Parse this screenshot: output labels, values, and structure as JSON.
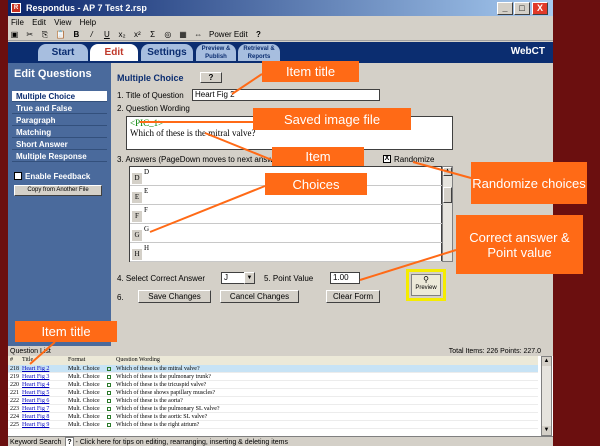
{
  "window": {
    "title": "Respondus - AP 7 Test 2.rsp",
    "controls": [
      "_",
      "□",
      "X"
    ]
  },
  "menu": [
    "File",
    "Edit",
    "View",
    "Help"
  ],
  "toolbar": [
    "▣",
    "✂",
    "⎘",
    "📋",
    "B",
    "/",
    "U",
    "x₂",
    "x²",
    "Σ",
    "◎",
    "▦",
    "⇔",
    "Power Edit",
    "?"
  ],
  "tabs": {
    "start": "Start",
    "edit": "Edit",
    "settings": "Settings",
    "preview_publish": "Preview & Publish",
    "retrieval_reports": "Retrieval & Reports",
    "brand": "WebCT"
  },
  "sidebar": {
    "heading": "Edit Questions",
    "items": [
      {
        "label": "Multiple Choice",
        "active": true
      },
      {
        "label": "True and False"
      },
      {
        "label": "Paragraph"
      },
      {
        "label": "Matching"
      },
      {
        "label": "Short Answer"
      },
      {
        "label": "Multiple Response"
      }
    ],
    "enable_feedback": "Enable Feedback",
    "copy_button": "Copy from Another File"
  },
  "form": {
    "type_title": "Multiple Choice",
    "help_button": "?",
    "step1_label": "1.   Title of Question",
    "title_value": "Heart Fig 2",
    "step2_label": "2.   Question Wording",
    "wording_tag": "<PIC_1>",
    "wording_text": "Which of these is the mitral valve?",
    "step3_label": "3.   Answers  (PageDown moves to next answer)",
    "randomize_label": "Randomize",
    "randomize_mark": "X",
    "choices": [
      {
        "letter": "D",
        "text": "D"
      },
      {
        "letter": "E",
        "text": "E"
      },
      {
        "letter": "F",
        "text": "F"
      },
      {
        "letter": "G",
        "text": "G"
      },
      {
        "letter": "H",
        "text": "H"
      }
    ],
    "step4_label": "4.   Select Correct Answer",
    "correct_answer": "J",
    "step5_label": "5.   Point Value",
    "point_value": "1.00",
    "step6_label": "6.",
    "save_button": "Save Changes",
    "cancel_button": "Cancel Changes",
    "clear_button": "Clear Form",
    "preview_button": "Preview"
  },
  "question_list": {
    "title": "Question List",
    "totals": "Total Items: 226  Points: 227.0",
    "columns": [
      "#",
      "Title",
      "Format",
      "",
      "Question Wording"
    ],
    "rows": [
      {
        "num": "218",
        "title": "Heart Fig 2",
        "format": "Mult. Choice",
        "wording": "Which of these is the mitral valve?",
        "selected": true
      },
      {
        "num": "219",
        "title": "Heart Fig 3",
        "format": "Mult. Choice",
        "wording": "Which of these is the pulmonary trunk?"
      },
      {
        "num": "220",
        "title": "Heart Fig 4",
        "format": "Mult. Choice",
        "wording": "Which of these is the tricuspid valve?"
      },
      {
        "num": "221",
        "title": "Heart Fig 5",
        "format": "Mult. Choice",
        "wording": "Which of these shows papillary muscles?"
      },
      {
        "num": "222",
        "title": "Heart Fig 6",
        "format": "Mult. Choice",
        "wording": "Which of these is the aorta?"
      },
      {
        "num": "223",
        "title": "Heart Fig 7",
        "format": "Mult. Choice",
        "wording": "Which of these is the pulmonary SL valve?"
      },
      {
        "num": "224",
        "title": "Heart Fig 8",
        "format": "Mult. Choice",
        "wording": "Which of these is the aortic SL valve?"
      },
      {
        "num": "225",
        "title": "Heart Fig 9",
        "format": "Mult. Choice",
        "wording": "Which of these is the right atrium?"
      }
    ]
  },
  "status_bar": {
    "keyword_search": "Keyword Search",
    "help_icon": "?",
    "tip": "- Click here for tips on editing, rearranging, inserting & deleting items"
  },
  "callouts": {
    "item_title_top": "Item title",
    "saved_image": "Saved image file",
    "item": "Item",
    "choices": "Choices",
    "randomize": "Randomize choices",
    "correct": "Correct answer & Point value",
    "item_title_bottom": "Item title"
  },
  "colors": {
    "background": "#6b0f0f",
    "callout": "#ff6a16",
    "sidebar": "#4a6a9c",
    "tabbar": "#0b2d70",
    "highlight": "#f5ec00"
  }
}
